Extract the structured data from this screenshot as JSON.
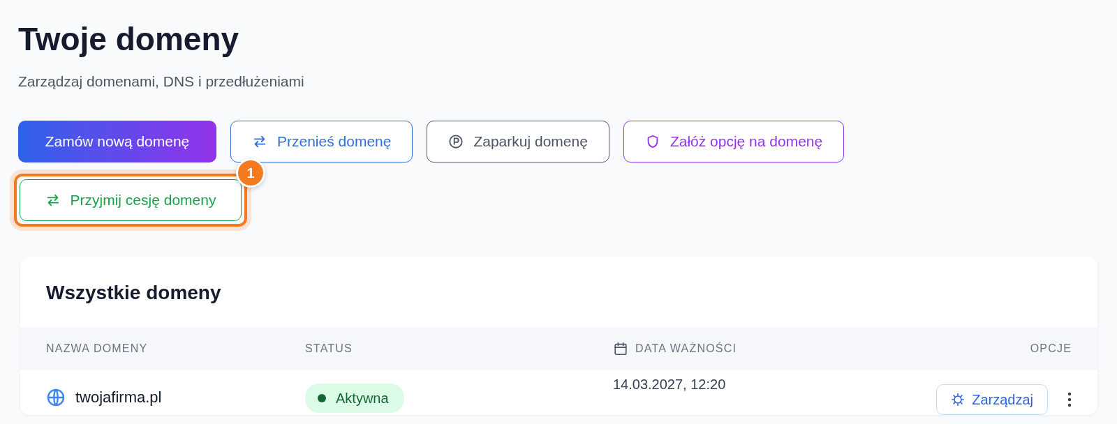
{
  "page": {
    "title": "Twoje domeny",
    "subtitle": "Zarządzaj domenami, DNS i przedłużeniami"
  },
  "actions": [
    {
      "label": "Zamów nową domenę",
      "kind": "primary"
    },
    {
      "label": "Przenieś domenę",
      "kind": "transfer",
      "color": "#2f6fdc"
    },
    {
      "label": "Zaparkuj domenę",
      "kind": "park",
      "color": "#4b5563"
    },
    {
      "label": "Załóż opcję na domenę",
      "kind": "option",
      "color": "#9333ea"
    },
    {
      "label": "Przyjmij cesję domeny",
      "kind": "cession",
      "color": "#16a34a",
      "callout": "1"
    }
  ],
  "card": {
    "title": "Wszystkie domeny",
    "columns": [
      {
        "label": "NAZWA DOMENY",
        "kind": "text"
      },
      {
        "label": "STATUS",
        "kind": "text"
      },
      {
        "label": "DATA WAŻNOŚCI",
        "kind": "date"
      },
      {
        "label": "OPCJE",
        "kind": "end"
      }
    ],
    "rows": [
      {
        "domain": "twojafirma.pl",
        "status": {
          "label": "Aktywna",
          "color": "#166534"
        },
        "expires": "14.03.2027, 12:20",
        "manage": "Zarządzaj"
      }
    ]
  }
}
